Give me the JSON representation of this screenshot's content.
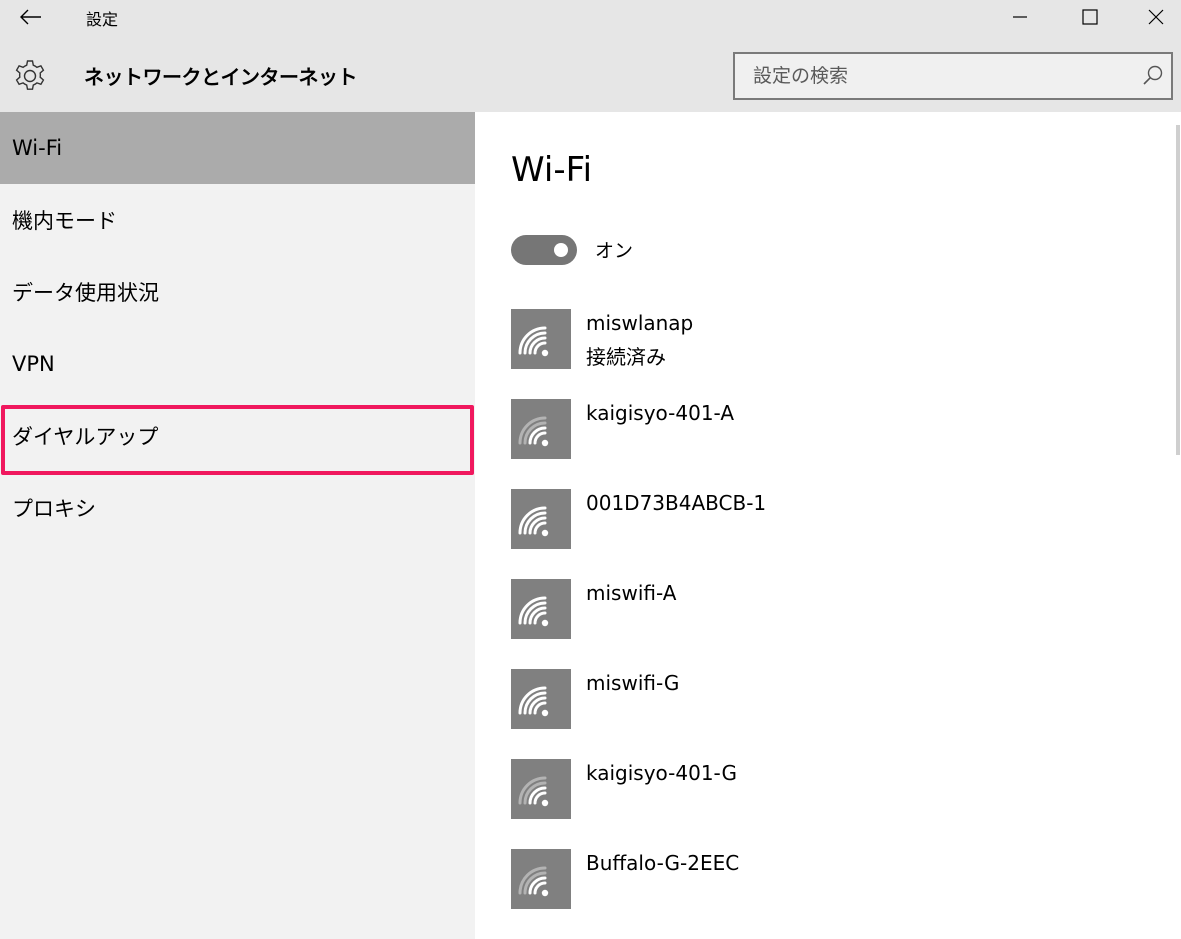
{
  "window": {
    "title": "設定",
    "back_icon": "back-arrow-icon",
    "minimize_icon": "minimize-icon",
    "maximize_icon": "maximize-icon",
    "close_icon": "close-icon"
  },
  "header": {
    "icon": "gear-icon",
    "title": "ネットワークとインターネット",
    "search": {
      "placeholder": "設定の検索",
      "value": "",
      "icon": "search-icon"
    }
  },
  "sidebar": {
    "items": [
      {
        "label": "Wi-Fi",
        "selected": true
      },
      {
        "label": "機内モード",
        "selected": false
      },
      {
        "label": "データ使用状況",
        "selected": false
      },
      {
        "label": "VPN",
        "selected": false
      },
      {
        "label": "ダイヤルアップ",
        "selected": false,
        "highlighted": true
      },
      {
        "label": "プロキシ",
        "selected": false
      }
    ]
  },
  "main": {
    "title": "Wi-Fi",
    "toggle": {
      "state": "on",
      "label": "オン"
    },
    "networks": [
      {
        "name": "miswlanap",
        "status": "接続済み",
        "icon": "wifi-signal-icon",
        "signal": "strong"
      },
      {
        "name": "kaigisyo-401-A",
        "status": "",
        "icon": "wifi-signal-icon",
        "signal": "weak"
      },
      {
        "name": "001D73B4ABCB-1",
        "status": "",
        "icon": "wifi-signal-icon",
        "signal": "strong"
      },
      {
        "name": "miswifi-A",
        "status": "",
        "icon": "wifi-signal-icon",
        "signal": "strong"
      },
      {
        "name": "miswifi-G",
        "status": "",
        "icon": "wifi-signal-icon",
        "signal": "strong"
      },
      {
        "name": "kaigisyo-401-G",
        "status": "",
        "icon": "wifi-signal-icon",
        "signal": "weak"
      },
      {
        "name": "Buffalo-G-2EEC",
        "status": "",
        "icon": "wifi-signal-icon",
        "signal": "weak"
      }
    ]
  },
  "colors": {
    "chrome": "#e6e6e6",
    "sidebar": "#f2f2f2",
    "selected": "#ababab",
    "highlight": "#f0185e",
    "tile": "#808080",
    "toggle": "#767676"
  }
}
